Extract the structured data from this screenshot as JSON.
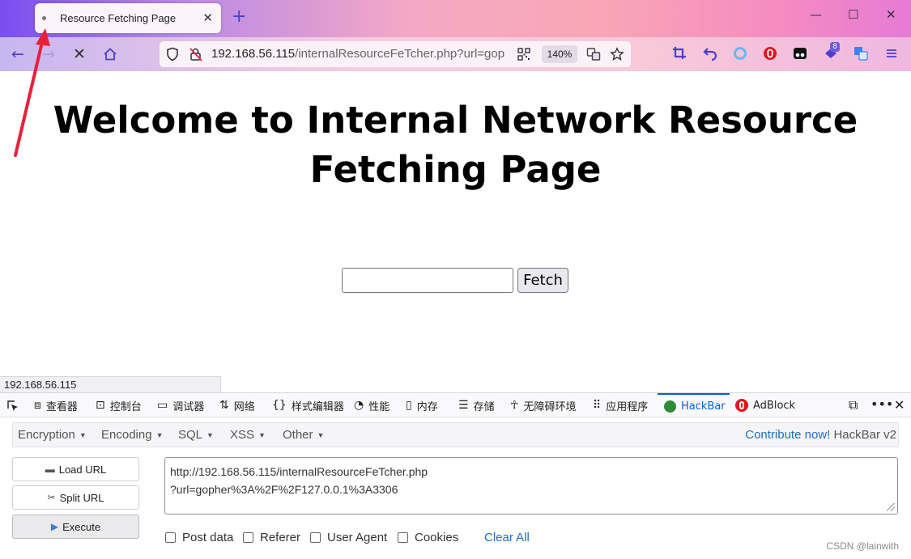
{
  "browser": {
    "tab_title": "Resource Fetching Page",
    "tab_close": "✕",
    "new_tab": "+",
    "window_controls": {
      "minimize": "—",
      "maximize": "☐",
      "close": "✕"
    },
    "url_host": "192.168.56.115",
    "url_rest": "/internalResourceFeTcher.php?url=gop",
    "zoom": "140%",
    "extension_badge": "8"
  },
  "page": {
    "heading": "Welcome to Internal Network Resource Fetching Page",
    "fetch_input_value": "",
    "fetch_button": "Fetch"
  },
  "status_bar": "192.168.56.115",
  "devtools": {
    "tabs": [
      {
        "label": "查看器",
        "icon": "inspector-icon"
      },
      {
        "label": "控制台",
        "icon": "console-icon"
      },
      {
        "label": "调试器",
        "icon": "debugger-icon"
      },
      {
        "label": "网络",
        "icon": "network-icon"
      },
      {
        "label": "样式编辑器",
        "icon": "style-editor-icon"
      },
      {
        "label": "性能",
        "icon": "performance-icon"
      },
      {
        "label": "内存",
        "icon": "memory-icon"
      },
      {
        "label": "存储",
        "icon": "storage-icon"
      },
      {
        "label": "无障碍环境",
        "icon": "accessibility-icon"
      },
      {
        "label": "应用程序",
        "icon": "application-icon"
      },
      {
        "label": "HackBar",
        "icon": "hackbar-icon"
      },
      {
        "label": "AdBlock",
        "icon": "adblock-icon"
      }
    ],
    "active_tab": "HackBar"
  },
  "hackbar": {
    "menus": [
      "Encryption",
      "Encoding",
      "SQL",
      "XSS",
      "Other"
    ],
    "contribute_link": "Contribute now!",
    "version": "HackBar v2",
    "buttons": {
      "load_url": "Load URL",
      "split_url": "Split URL",
      "execute": "Execute"
    },
    "url_line1": "http://192.168.56.115/internalResourceFeTcher.php",
    "url_line2": "?url=gopher%3A%2F%2F127.0.0.1%3A3306",
    "checkboxes": [
      "Post data",
      "Referer",
      "User Agent",
      "Cookies"
    ],
    "clear_all": "Clear All"
  },
  "watermark": "CSDN @lainwith",
  "colors": {
    "accent_blue": "#0060df",
    "hackbar_link": "#1f6fc5",
    "annotation_arrow": "#e8203a"
  }
}
